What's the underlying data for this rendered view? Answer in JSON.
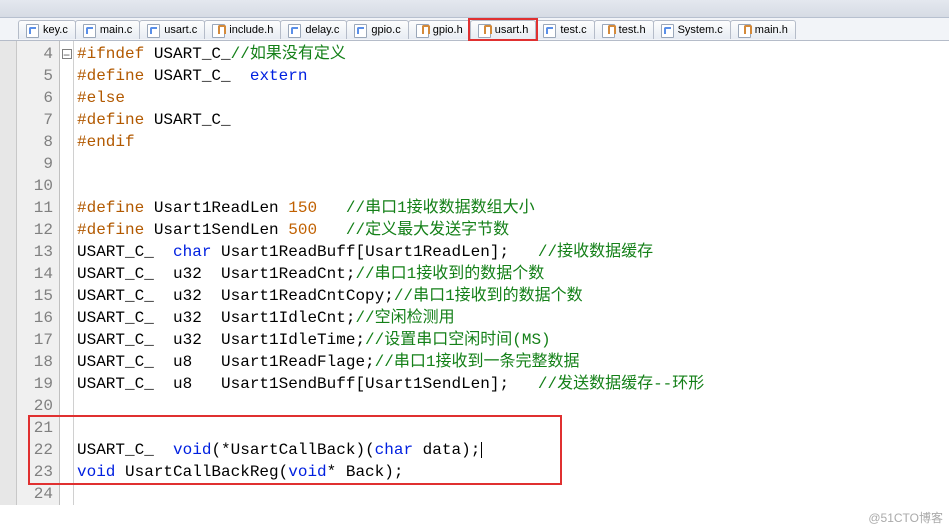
{
  "tabs": [
    {
      "label": "key.c",
      "icon": "c",
      "active": false
    },
    {
      "label": "main.c",
      "icon": "c",
      "active": false
    },
    {
      "label": "usart.c",
      "icon": "c",
      "active": false
    },
    {
      "label": "include.h",
      "icon": "h",
      "active": false
    },
    {
      "label": "delay.c",
      "icon": "c",
      "active": false
    },
    {
      "label": "gpio.c",
      "icon": "c",
      "active": false
    },
    {
      "label": "gpio.h",
      "icon": "h",
      "active": false
    },
    {
      "label": "usart.h",
      "icon": "h",
      "active": true
    },
    {
      "label": "test.c",
      "icon": "c",
      "active": false
    },
    {
      "label": "test.h",
      "icon": "h",
      "active": false
    },
    {
      "label": "System.c",
      "icon": "c",
      "active": false
    },
    {
      "label": "main.h",
      "icon": "h",
      "active": false
    }
  ],
  "lines": [
    {
      "n": 4,
      "fold": true,
      "segs": [
        [
          "pre",
          "#ifndef"
        ],
        [
          "id",
          " USART_C_"
        ],
        [
          "com",
          "//如果没有定义"
        ]
      ]
    },
    {
      "n": 5,
      "segs": [
        [
          "pre",
          "#define"
        ],
        [
          "id",
          " USART_C_ "
        ],
        [
          "kw",
          " extern"
        ]
      ]
    },
    {
      "n": 6,
      "segs": [
        [
          "pre",
          "#else"
        ]
      ]
    },
    {
      "n": 7,
      "segs": [
        [
          "pre",
          "#define"
        ],
        [
          "id",
          " USART_C_"
        ]
      ]
    },
    {
      "n": 8,
      "segs": [
        [
          "pre",
          "#endif"
        ]
      ]
    },
    {
      "n": 9,
      "segs": []
    },
    {
      "n": 10,
      "segs": []
    },
    {
      "n": 11,
      "segs": [
        [
          "pre",
          "#define"
        ],
        [
          "id",
          " Usart1ReadLen "
        ],
        [
          "num",
          "150"
        ],
        [
          "id",
          "   "
        ],
        [
          "com",
          "//串口1接收数据数组大小"
        ]
      ]
    },
    {
      "n": 12,
      "segs": [
        [
          "pre",
          "#define"
        ],
        [
          "id",
          " Usart1SendLen "
        ],
        [
          "num",
          "500"
        ],
        [
          "id",
          "   "
        ],
        [
          "com",
          "//定义最大发送字节数"
        ]
      ]
    },
    {
      "n": 13,
      "segs": [
        [
          "id",
          "USART_C_ "
        ],
        [
          "kw",
          " char"
        ],
        [
          "id",
          " Usart1ReadBuff[Usart1ReadLen];   "
        ],
        [
          "com",
          "//接收数据缓存"
        ]
      ]
    },
    {
      "n": 14,
      "segs": [
        [
          "id",
          "USART_C_  u32  Usart1ReadCnt;"
        ],
        [
          "com",
          "//串口1接收到的数据个数"
        ]
      ]
    },
    {
      "n": 15,
      "segs": [
        [
          "id",
          "USART_C_  u32  Usart1ReadCntCopy;"
        ],
        [
          "com",
          "//串口1接收到的数据个数"
        ]
      ]
    },
    {
      "n": 16,
      "segs": [
        [
          "id",
          "USART_C_  u32  Usart1IdleCnt;"
        ],
        [
          "com",
          "//空闲检测用"
        ]
      ]
    },
    {
      "n": 17,
      "segs": [
        [
          "id",
          "USART_C_  u32  Usart1IdleTime;"
        ],
        [
          "com",
          "//设置串口空闲时间(MS)"
        ]
      ]
    },
    {
      "n": 18,
      "segs": [
        [
          "id",
          "USART_C_  u8   Usart1ReadFlage;"
        ],
        [
          "com",
          "//串口1接收到一条完整数据"
        ]
      ]
    },
    {
      "n": 19,
      "segs": [
        [
          "id",
          "USART_C_  u8   Usart1SendBuff[Usart1SendLen];   "
        ],
        [
          "com",
          "//发送数据缓存--环形"
        ]
      ]
    },
    {
      "n": 20,
      "segs": []
    },
    {
      "n": 21,
      "segs": []
    },
    {
      "n": 22,
      "caret": true,
      "segs": [
        [
          "id",
          "USART_C_ "
        ],
        [
          "kw",
          " void"
        ],
        [
          "id",
          "(*UsartCallBack)("
        ],
        [
          "kw",
          "char"
        ],
        [
          "id",
          " data);"
        ]
      ]
    },
    {
      "n": 23,
      "segs": [
        [
          "kw",
          "void"
        ],
        [
          "id",
          " UsartCallBackReg("
        ],
        [
          "kw",
          "void"
        ],
        [
          "id",
          "* Back);"
        ]
      ]
    },
    {
      "n": 24,
      "segs": []
    }
  ],
  "watermark": "@51CTO博客",
  "highlight_tab_index": 7,
  "red_box_lines": {
    "from": 21,
    "to": 23
  }
}
